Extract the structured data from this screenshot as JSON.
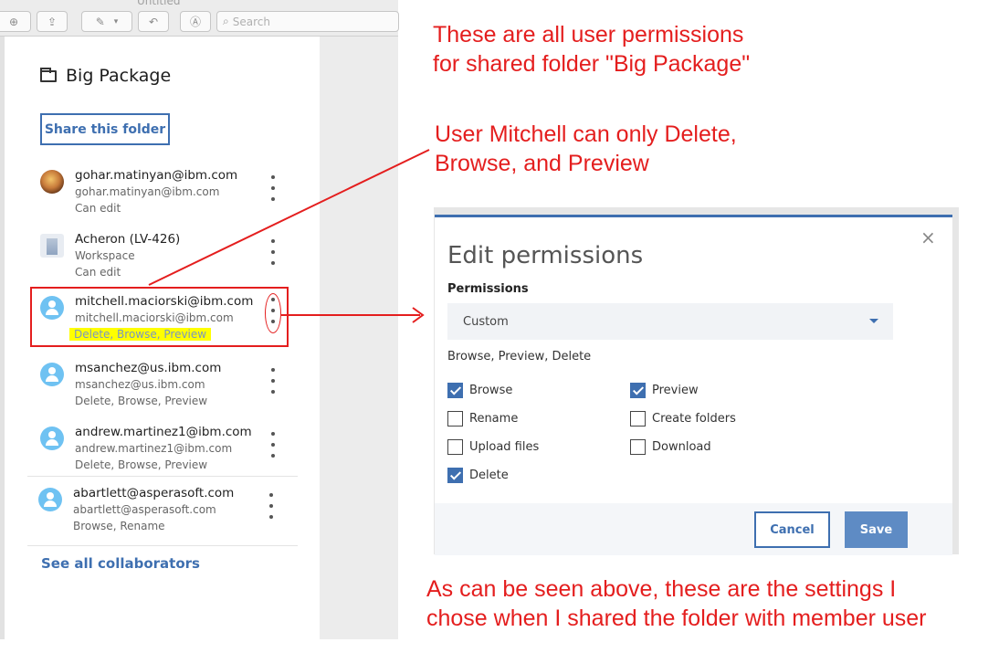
{
  "toolbar": {
    "window_title": "Untitled",
    "search_placeholder": "Search",
    "zoom_icon": "zoom-in-icon",
    "share_icon": "share-icon",
    "pen_icon": "pen-icon",
    "chevron_icon": "chevron-down-icon",
    "rotate_icon": "rotate-icon",
    "markup_icon": "markup-icon"
  },
  "panel": {
    "folder_title": "Big Package",
    "share_button": "Share this folder",
    "see_all": "See all collaborators",
    "collaborators": [
      {
        "email": "gohar.matinyan@ibm.com",
        "sub": "gohar.matinyan@ibm.com",
        "permission": "Can edit",
        "avatar": "photo"
      },
      {
        "email": "Acheron (LV-426)",
        "sub": "Workspace",
        "permission": "Can edit",
        "avatar": "building"
      },
      {
        "email": "mitchell.maciorski@ibm.com",
        "sub": "mitchell.maciorski@ibm.com",
        "permission": "Delete, Browse, Preview",
        "avatar": "default"
      },
      {
        "email": "msanchez@us.ibm.com",
        "sub": "msanchez@us.ibm.com",
        "permission": "Delete, Browse, Preview",
        "avatar": "default"
      },
      {
        "email": "andrew.martinez1@ibm.com",
        "sub": "andrew.martinez1@ibm.com",
        "permission": "Delete, Browse, Preview",
        "avatar": "default"
      },
      {
        "email": "abartlett@asperasoft.com",
        "sub": "abartlett@asperasoft.com",
        "permission": "Browse, Rename",
        "avatar": "default"
      }
    ]
  },
  "annotations": {
    "top_line1": "These are all user permissions",
    "top_line2": "for shared folder \"Big Package\"",
    "mid_line1": "User Mitchell can only Delete,",
    "mid_line2": "Browse, and Preview",
    "bottom_line1": "As can be seen above, these are the settings I",
    "bottom_line2": "chose when I shared the folder with member user",
    "color": "#e41e1e"
  },
  "dialog": {
    "title": "Edit permissions",
    "close_glyph": "×",
    "permissions_label": "Permissions",
    "select_value": "Custom",
    "summary": "Browse, Preview, Delete",
    "checkboxes": [
      {
        "label": "Browse",
        "checked": true
      },
      {
        "label": "Preview",
        "checked": true
      },
      {
        "label": "Rename",
        "checked": false
      },
      {
        "label": "Create folders",
        "checked": false
      },
      {
        "label": "Upload files",
        "checked": false
      },
      {
        "label": "Download",
        "checked": false
      },
      {
        "label": "Delete",
        "checked": true
      }
    ],
    "cancel": "Cancel",
    "save": "Save",
    "accent": "#3e6fb0"
  }
}
